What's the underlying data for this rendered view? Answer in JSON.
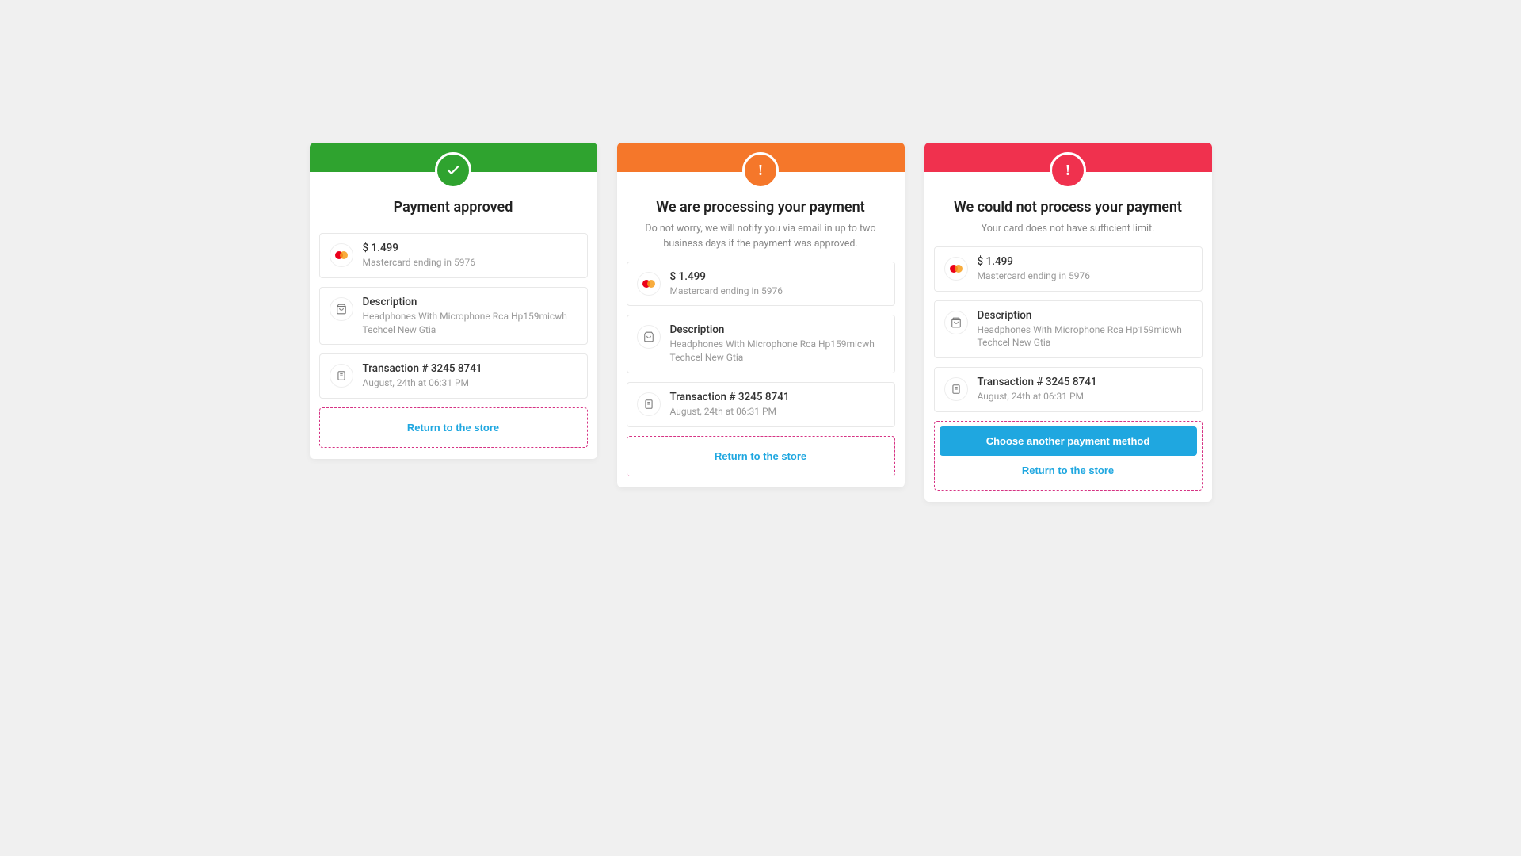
{
  "cards": {
    "approved": {
      "title": "Payment approved",
      "subtitle": null,
      "amount": "$ 1.499",
      "card_text": "Mastercard ending in 5976",
      "desc_label": "Description",
      "desc_text": "Headphones With Microphone Rca Hp159micwh Techcel New Gtia",
      "txn_label": "Transaction # 3245 8741",
      "txn_time": "August, 24th at 06:31 PM",
      "primary_btn": null,
      "return_btn": "Return to the store"
    },
    "processing": {
      "title": "We are processing your payment",
      "subtitle": "Do not worry, we will notify you via email in up to two business days if the payment was approved.",
      "amount": "$ 1.499",
      "card_text": "Mastercard ending in 5976",
      "desc_label": "Description",
      "desc_text": "Headphones With Microphone Rca Hp159micwh Techcel New Gtia",
      "txn_label": "Transaction # 3245 8741",
      "txn_time": "August, 24th at 06:31 PM",
      "primary_btn": null,
      "return_btn": "Return to the store"
    },
    "failed": {
      "title": "We could not process your payment",
      "subtitle": "Your card does not have sufficient limit.",
      "amount": "$ 1.499",
      "card_text": "Mastercard ending in 5976",
      "desc_label": "Description",
      "desc_text": "Headphones With Microphone Rca Hp159micwh Techcel New Gtia",
      "txn_label": "Transaction # 3245 8741",
      "txn_time": "August, 24th at 06:31 PM",
      "primary_btn": "Choose another payment method",
      "return_btn": "Return to the store"
    }
  }
}
